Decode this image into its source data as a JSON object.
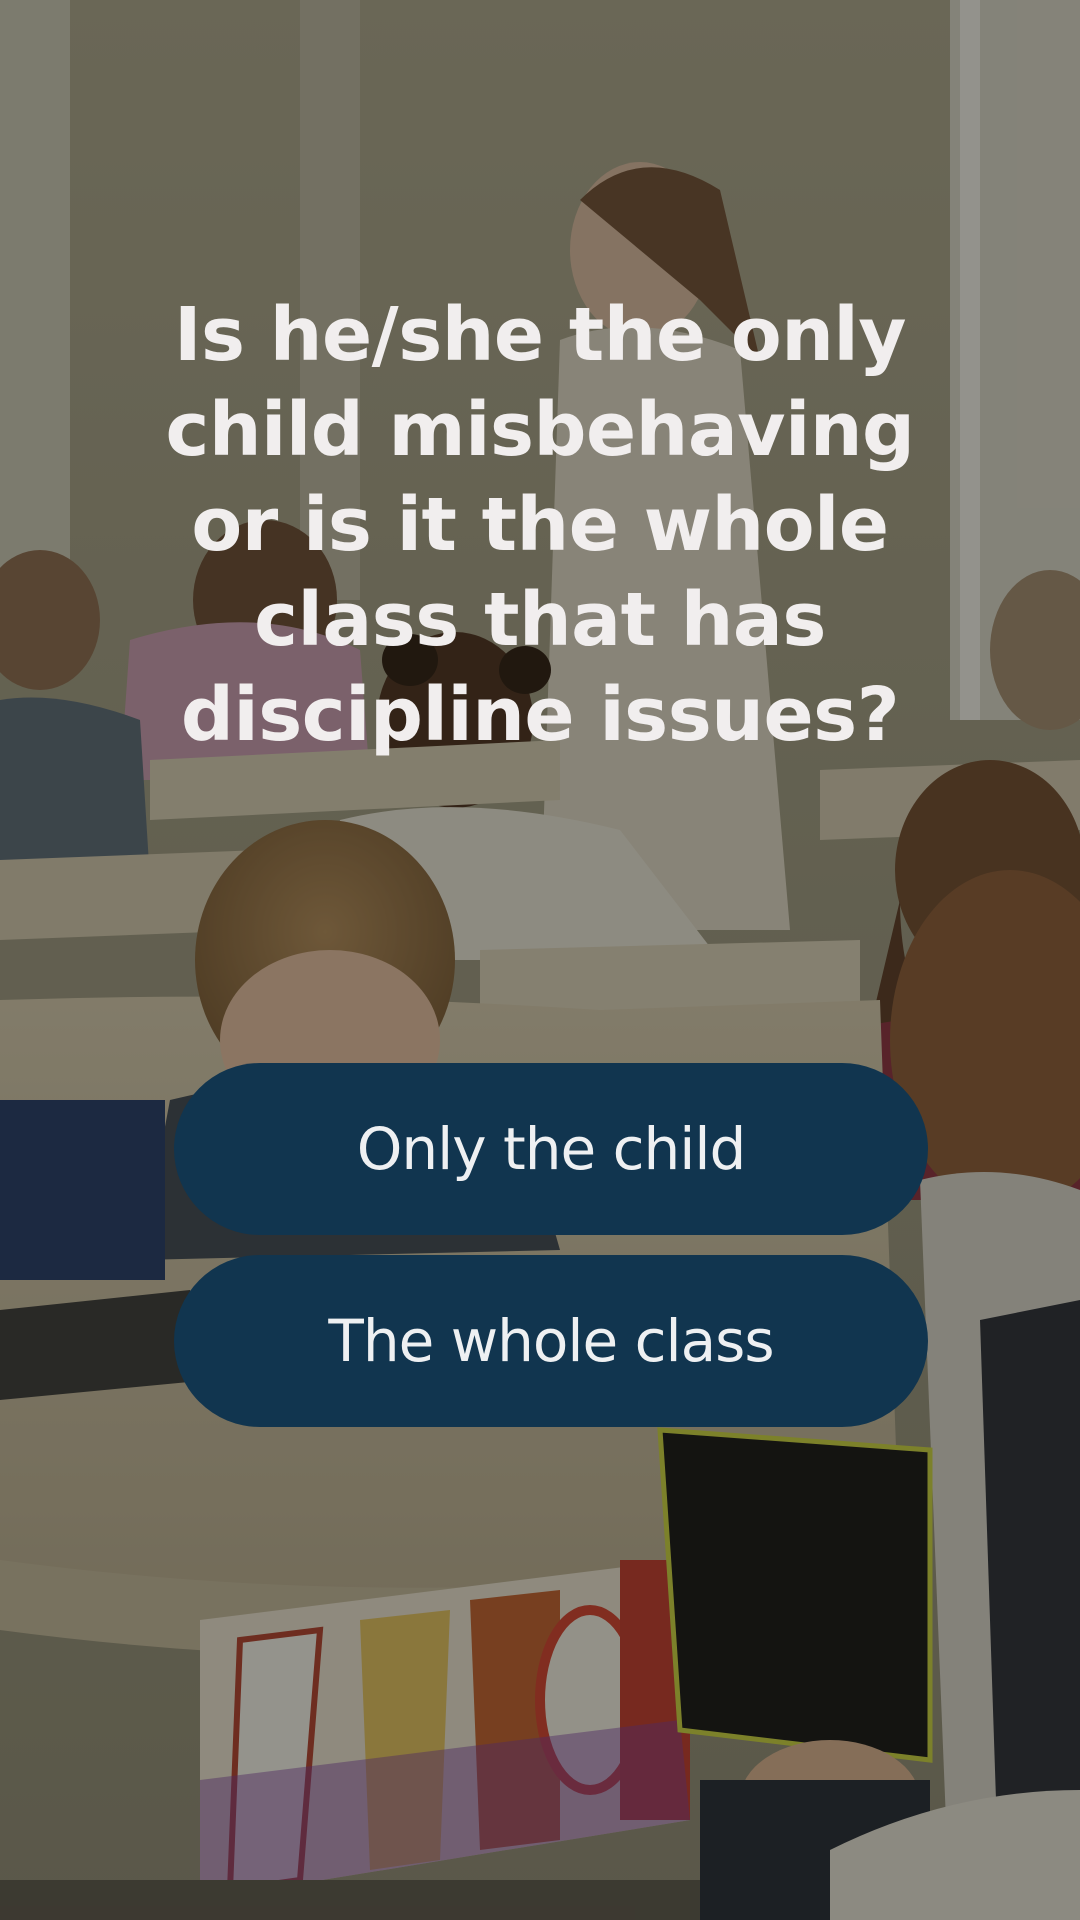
{
  "question": {
    "text": "Is he/she the only child misbehaving or is it the whole class that has discipline issues?"
  },
  "answers": [
    {
      "label": "Only the child"
    },
    {
      "label": "The whole class"
    }
  ],
  "theme": {
    "button_color": "#11354f",
    "button_text_color": "#eef0f2",
    "question_text_color": "#f1eeee"
  },
  "background": {
    "image": "classroom-photo"
  }
}
